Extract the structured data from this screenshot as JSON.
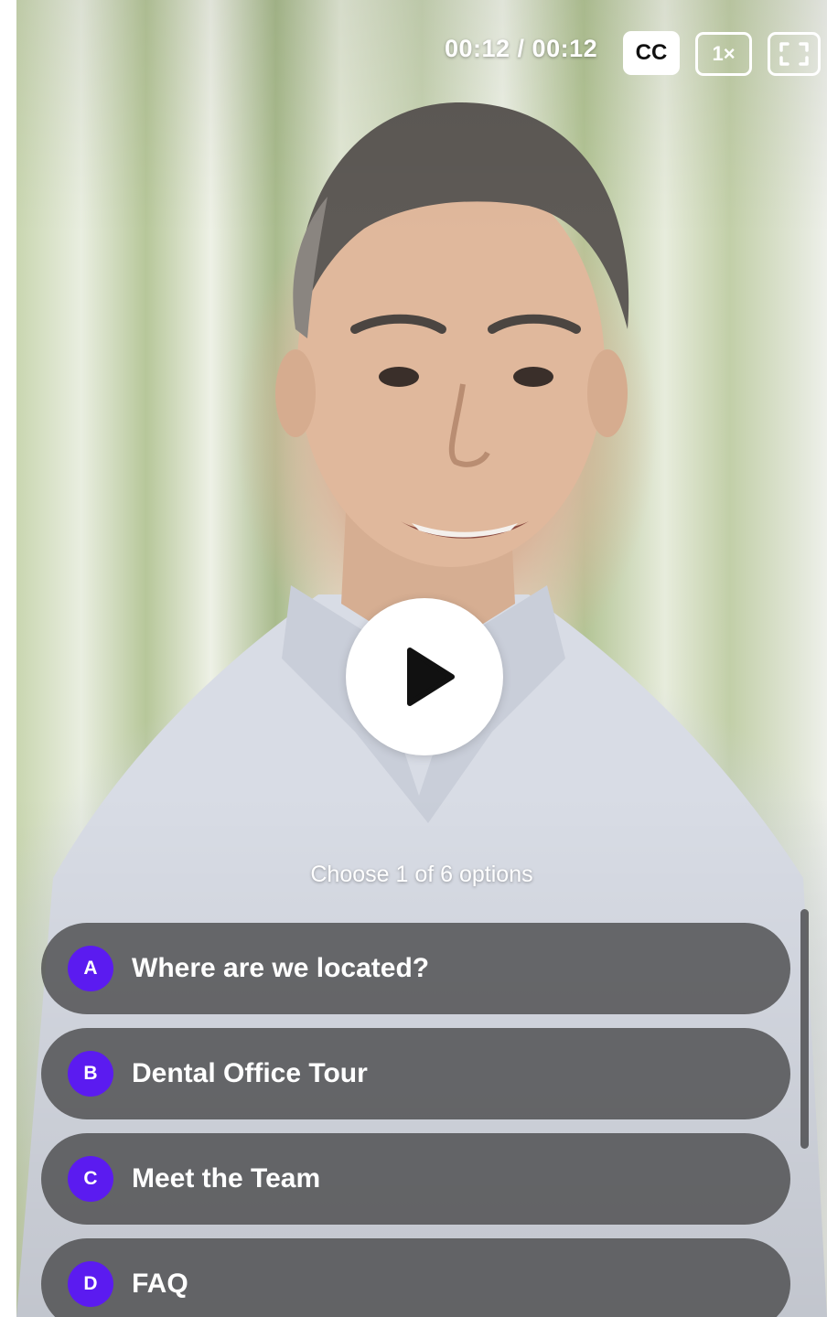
{
  "player": {
    "time": "00:12 / 00:12",
    "cc_label": "CC",
    "speed_label": "1×",
    "fullscreen_icon": "fullscreen-icon",
    "play_icon": "play-icon"
  },
  "choices": {
    "prompt": "Choose 1 of 6 options",
    "options": [
      {
        "letter": "A",
        "label": "Where are we located?"
      },
      {
        "letter": "B",
        "label": "Dental Office Tour"
      },
      {
        "letter": "C",
        "label": "Meet the Team"
      },
      {
        "letter": "D",
        "label": "FAQ"
      }
    ]
  },
  "colors": {
    "accent": "#5b1bf0",
    "option_bg": "#464648"
  }
}
